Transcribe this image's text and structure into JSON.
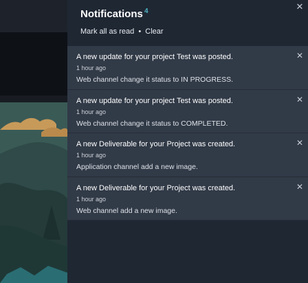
{
  "notifications": {
    "title": "Notifications",
    "count": "4",
    "mark_all_read": "Mark all as read",
    "separator": "•",
    "clear": "Clear",
    "close_icon": "close-icon",
    "items": [
      {
        "headline": "A new update for your project Test was posted.",
        "time": "1 hour ago",
        "body": "Web channel change it status to IN PROGRESS."
      },
      {
        "headline": "A new update for your project Test was posted.",
        "time": "1 hour ago",
        "body": "Web channel change it status to COMPLETED."
      },
      {
        "headline": "A new Deliverable for your Project was created.",
        "time": "1 hour ago",
        "body": "Application channel add a new image."
      },
      {
        "headline": "A new Deliverable for your Project was created.",
        "time": "1 hour ago",
        "body": "Web channel add a new image."
      }
    ]
  },
  "colors": {
    "panel_bg": "#1f2733",
    "item_bg": "#313a47",
    "badge": "#4fb3c4"
  }
}
